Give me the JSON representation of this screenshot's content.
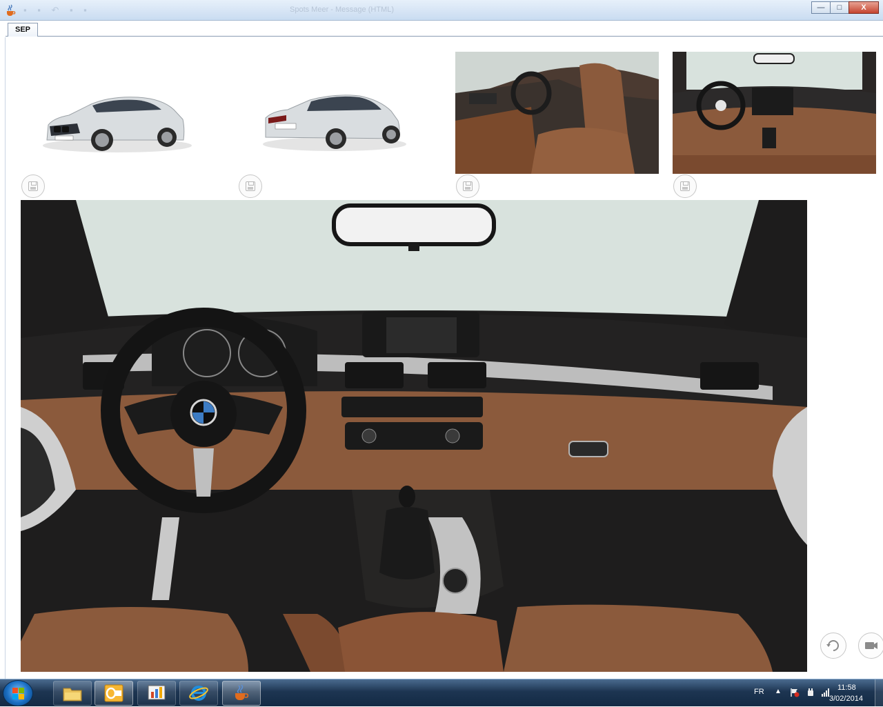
{
  "window": {
    "title": "Spots Meer - Message (HTML)",
    "controls": {
      "minimize": "—",
      "maximize": "□",
      "close": "X"
    }
  },
  "tabs": [
    {
      "label": "SEP"
    }
  ],
  "thumbnails": [
    {
      "kind": "exterior",
      "view": "front-three-quarter",
      "car_color": "#d9dde0"
    },
    {
      "kind": "exterior",
      "view": "rear-three-quarter",
      "car_color": "#d9dde0"
    },
    {
      "kind": "interior",
      "view": "driver-door-interior",
      "upholstery": "#8b5a3c"
    },
    {
      "kind": "interior",
      "view": "dashboard",
      "upholstery": "#8b5a3c"
    }
  ],
  "main_view": {
    "subject": "dashboard",
    "upholstery": "#8b5a3c",
    "dash_top": "#2a2a2a",
    "trim": "#c9c9c9",
    "sky": "#d8e2dd"
  },
  "side_controls": [
    {
      "icon": "rotate-icon"
    },
    {
      "icon": "camera-icon"
    }
  ],
  "taskbar": {
    "items": [
      {
        "icon": "explorer-folder-icon",
        "active": false
      },
      {
        "icon": "outlook-icon",
        "active": true
      },
      {
        "icon": "presentation-icon",
        "active": false
      },
      {
        "icon": "internet-explorer-icon",
        "active": false
      },
      {
        "icon": "java-cup-icon",
        "active": true
      }
    ],
    "language": "FR",
    "time": "11:58",
    "date": "3/02/2014"
  }
}
